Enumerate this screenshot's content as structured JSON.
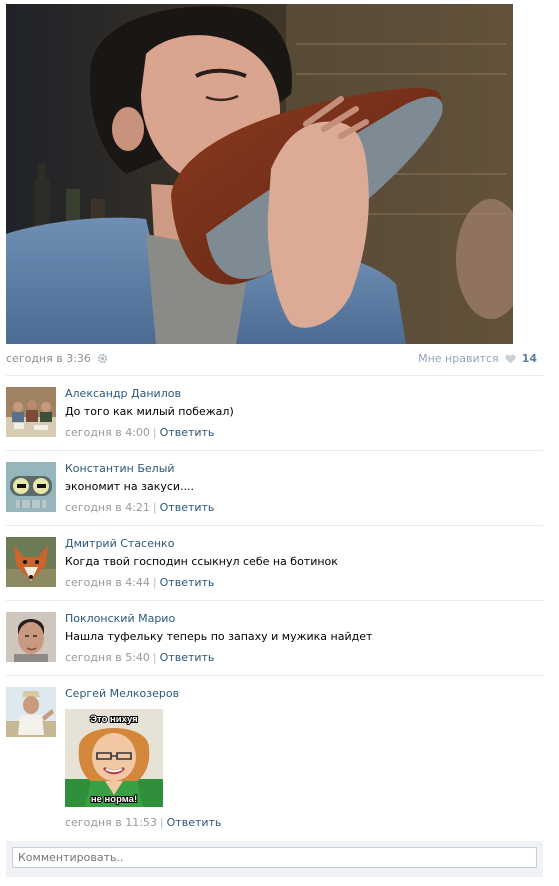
{
  "post": {
    "date": "сегодня в 3:36",
    "like_label": "Мне нравится",
    "like_count": "14"
  },
  "comments": [
    {
      "author": "Александр Данилов",
      "text": "До того как милый побежал)",
      "time": "сегодня в 4:00",
      "reply": "Ответить"
    },
    {
      "author": "Константин Белый",
      "text": "экономит на закуси....",
      "time": "сегодня в 4:21",
      "reply": "Ответить"
    },
    {
      "author": "Дмитрий Стасенко",
      "text": "Когда твой господин ссыкнул себе на ботинок",
      "time": "сегодня в 4:44",
      "reply": "Ответить"
    },
    {
      "author": "Поклонский Марио",
      "text": "Нашла туфельку теперь по запаху и мужика найдет",
      "time": "сегодня в 5:40",
      "reply": "Ответить"
    },
    {
      "author": "Сергей Мелкозеров",
      "time": "сегодня в 11:53",
      "reply": "Ответить",
      "sticker": {
        "top_text": "Это нихуя",
        "bottom_text": "не норма!"
      }
    }
  ],
  "comment_input": {
    "placeholder": "Комментировать.."
  },
  "colors": {
    "link": "#2b587a",
    "meta": "#999999",
    "like_count": "#5f7f9f",
    "input_bar": "#f0f2f5"
  }
}
